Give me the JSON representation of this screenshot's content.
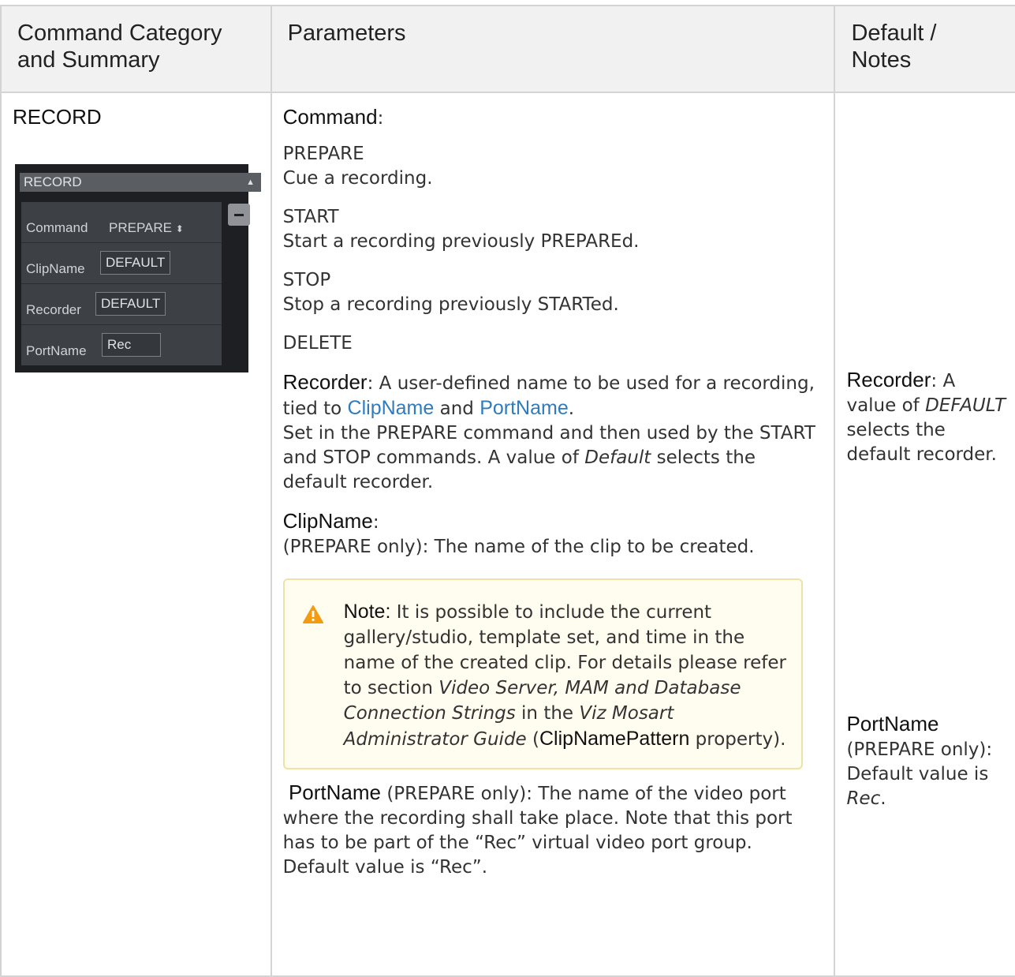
{
  "table": {
    "headers": [
      "Command Category and Summary",
      "Parameters",
      "Default / Notes"
    ],
    "category": "RECORD",
    "widget": {
      "dropdown_value": "RECORD",
      "command_label": "Command",
      "command_value": "PREPARE",
      "clipname_label": "ClipName",
      "clipname_value": "DEFAULT",
      "recorder_label": "Recorder",
      "recorder_value": "DEFAULT",
      "portname_label": "PortName",
      "portname_value": "Rec",
      "remove_icon": "minus-icon"
    },
    "params": {
      "command_term": "Command",
      "command_colon": ":",
      "prepare": "PREPARE",
      "prepare_desc": "Cue a recording.",
      "start": "START",
      "start_desc": "Start a recording previously PREPAREd.",
      "stop": "STOP",
      "stop_desc": "Stop a recording previously STARTed.",
      "delete": "DELETE",
      "recorder_term": "Recorder",
      "recorder_text1": ": A user-defined name to be used for a recording, tied to ",
      "clipname_link": "ClipName",
      "and": " and ",
      "portname_link": "PortName",
      "period": ".",
      "recorder_text2": "Set in the PREPARE command and then used by the START and STOP commands. A value of ",
      "default_em": "Default",
      "recorder_text3": " selects the default recorder.",
      "clipname_term": "ClipName",
      "clipname_colon": ":",
      "clipname_desc": "(PREPARE only): The name of the clip to be created.",
      "note": {
        "label": "Note:",
        "text1": " It is possible to include the current gallery/studio, template set, and time in the name of the created clip. For details please refer to section ",
        "ref1": "Video Server, MAM and Database Connection Strings",
        "text2": " in the ",
        "ref2": "Viz Mosart Administrator Guide",
        "text3": " (",
        "term": "ClipNamePattern",
        "text4": " property)."
      },
      "portname_term": "PortName",
      "portname_desc": " (PREPARE only): The name of the video port where the recording shall take place. Note that this port has to be part of the “Rec” virtual video port group.",
      "portname_default": "Default value is “Rec”."
    },
    "defaults": {
      "recorder_term": "Recorder",
      "recorder_text1": ": A value of ",
      "recorder_em": "DEFAULT",
      "recorder_text2": " selects the default recorder.",
      "portname_term": "PortName",
      "portname_text": "(PREPARE only): Default value is ",
      "portname_em": "Rec",
      "portname_period": "."
    }
  },
  "colors": {
    "link": "#2f7bbd",
    "note_bg": "#fffdf0",
    "note_border": "#ede3a6",
    "warning": "#f39c12",
    "header_bg": "#f1f1f1"
  }
}
